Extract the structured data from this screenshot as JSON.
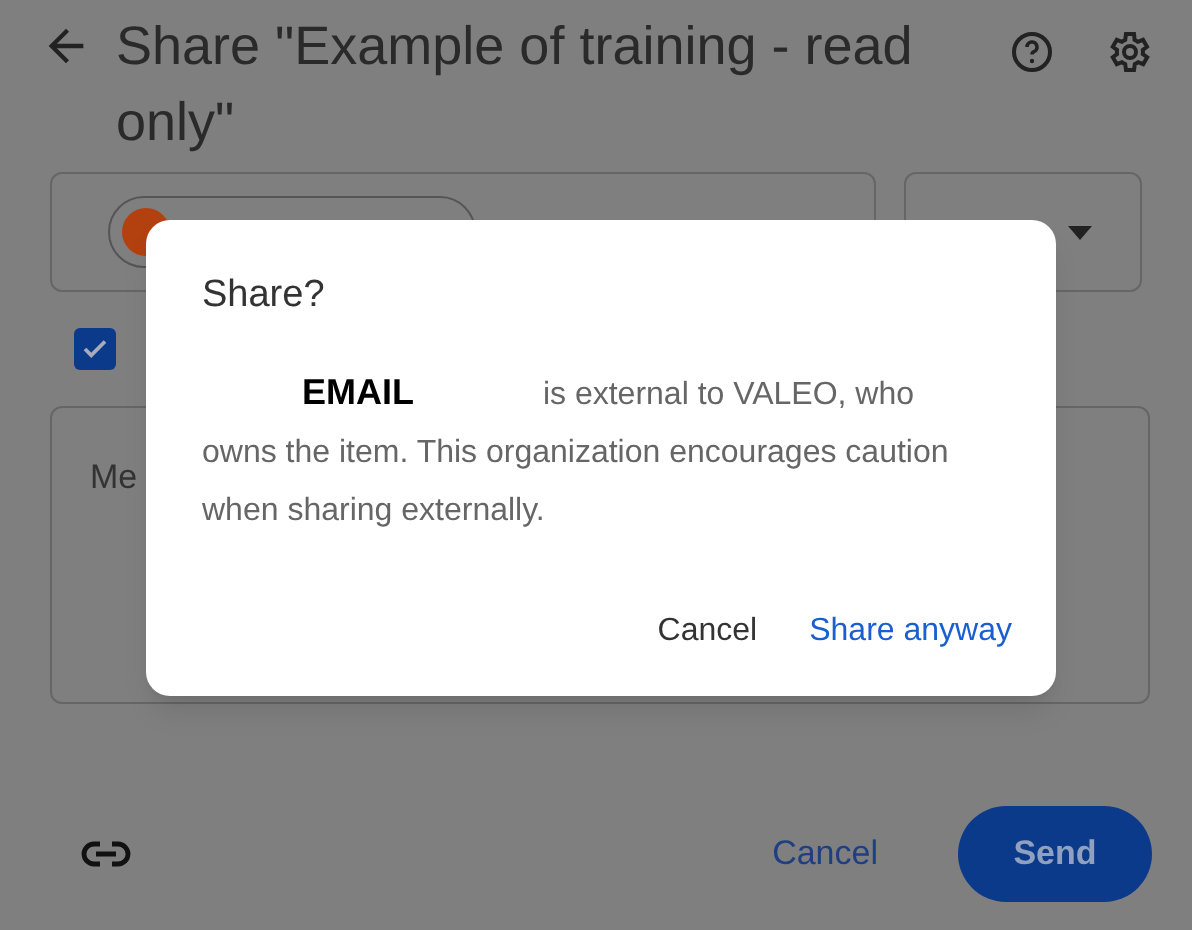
{
  "header": {
    "title": "Share \"Example of training - read only\""
  },
  "notify": {
    "checked": true
  },
  "message": {
    "placeholder": "Me"
  },
  "footer": {
    "cancel": "Cancel",
    "send": "Send"
  },
  "dialog": {
    "title": "Share?",
    "body": "**EMAIL** is external to VALEO, who owns the item. This organization encourages caution when sharing externally.",
    "cancel": "Cancel",
    "confirm": "Share anyway"
  }
}
